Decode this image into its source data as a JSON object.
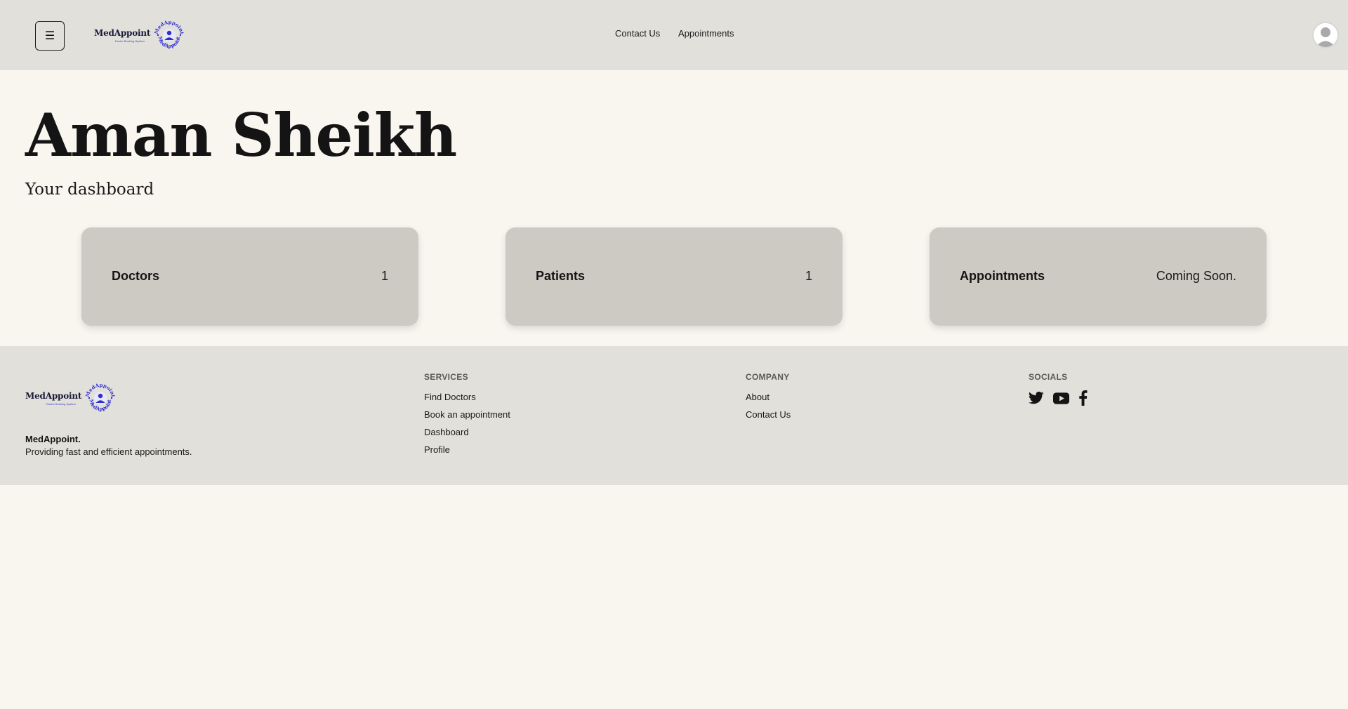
{
  "header": {
    "menu_icon": "☰",
    "logo_text": "MedAppoint",
    "logo_sub": "Doctor Booking System",
    "logo_ring_top": "MedAppoint",
    "logo_ring_bottom": "MedAppoint",
    "nav": {
      "contact": "Contact Us",
      "appointments": "Appointments"
    },
    "avatar_icon": "user-avatar-icon"
  },
  "main": {
    "title": "Aman Sheikh",
    "subtitle": "Your dashboard",
    "cards": [
      {
        "label": "Doctors",
        "value": "1"
      },
      {
        "label": "Patients",
        "value": "1"
      },
      {
        "label": "Appointments",
        "value": "Coming Soon."
      }
    ]
  },
  "footer": {
    "brand": "MedAppoint.",
    "tagline": "Providing fast and efficient appointments.",
    "services": {
      "heading": "SERVICES",
      "links": [
        "Find Doctors",
        "Book an appointment",
        "Dashboard",
        "Profile"
      ]
    },
    "company": {
      "heading": "COMPANY",
      "links": [
        "About",
        "Contact Us"
      ]
    },
    "socials": {
      "heading": "SOCIALS",
      "icons": [
        "twitter-icon",
        "youtube-icon",
        "facebook-icon"
      ]
    }
  },
  "colors": {
    "background": "#f8f6ef",
    "header_footer": "#e2e0da",
    "card": "#cdcac3",
    "logo_accent": "#3b3bd6"
  }
}
